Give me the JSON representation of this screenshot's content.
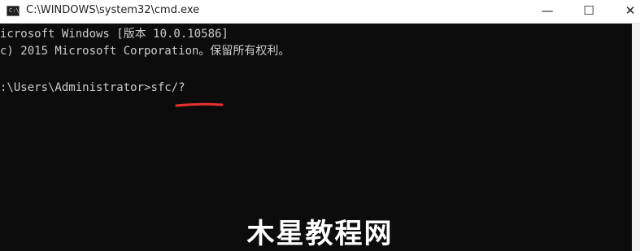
{
  "window": {
    "title": "C:\\WINDOWS\\system32\\cmd.exe",
    "icon": "cmd-icon",
    "controls": {
      "minimize": "—",
      "maximize": "☐",
      "close": "✕"
    }
  },
  "console": {
    "lines": [
      "icrosoft Windows [版本 10.0.10586]",
      "c) 2015 Microsoft Corporation。保留所有权利。",
      ":\\Users\\Administrator>"
    ],
    "command": "sfc/?",
    "underline_color": "#e8312f"
  },
  "watermark": {
    "text": "木星教程网"
  }
}
